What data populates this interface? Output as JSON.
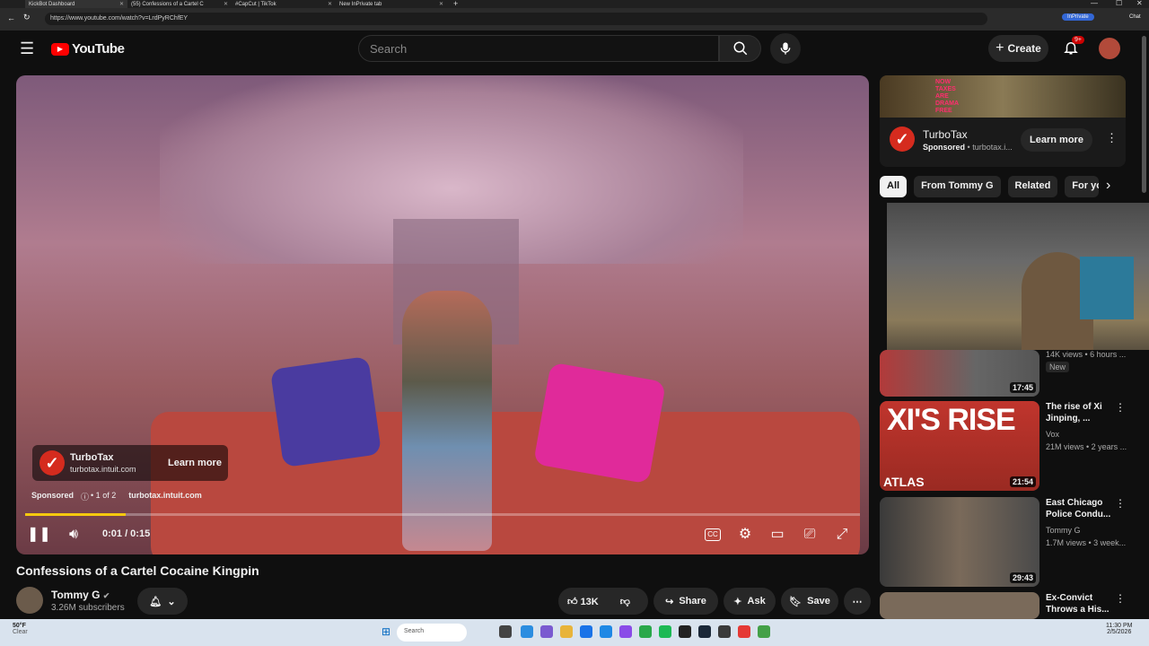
{
  "browser": {
    "tabs": [
      {
        "label": "KickBot Dashboard"
      },
      {
        "label": "(55) Confessions of a Cartel C"
      },
      {
        "label": "#CapCut | TikTok"
      },
      {
        "label": "New InPrivate tab"
      }
    ],
    "url": "https://www.youtube.com/watch?v=LrdPyRChfEY",
    "inprivate_label": "InPrivate",
    "chat_label": "Chat"
  },
  "header": {
    "logo": "YouTube",
    "search_placeholder": "Search",
    "create_label": "Create",
    "notif_badge": "9+"
  },
  "player": {
    "ad_title": "TurboTax",
    "ad_domain": "turbotax.intuit.com",
    "ad_button": "Learn more",
    "sponsored_label": "Sponsored",
    "ad_count": "• 1 of 2",
    "sponsored_domain": "turbotax.intuit.com",
    "time": "0:01 / 0:15",
    "progress_fraction": 0.12
  },
  "video": {
    "title": "Confessions of a Cartel Cocaine Kingpin",
    "channel": "Tommy G",
    "subscribers": "3.26M subscribers",
    "likes": "13K",
    "share_label": "Share",
    "ask_label": "Ask",
    "save_label": "Save"
  },
  "sidebar_ad": {
    "thumb_text": "NOW TAXES ARE DRAMA FREE",
    "advertiser": "TurboTax",
    "sponsored": "Sponsored",
    "domain": "turbotax.i...",
    "button": "Learn more"
  },
  "chips": [
    "All",
    "From Tommy G",
    "Related",
    "For you"
  ],
  "recommendations": [
    {
      "duration": "17:45",
      "meta1": "14K views • 6 hours ...",
      "badge": "New"
    },
    {
      "title": "The rise of Xi Jinping, ...",
      "channel": "Vox",
      "views": "21M views • 2 years ...",
      "duration": "21:54",
      "thumb_text": "XI'S RISE",
      "thumb_sub": "ATLAS"
    },
    {
      "title": "East Chicago Police Condu...",
      "channel": "Tommy G",
      "views": "1.7M views • 3 week...",
      "duration": "29:43"
    },
    {
      "title": "Ex-Convict Throws a His...",
      "channel": "",
      "views": ""
    }
  ],
  "taskbar": {
    "weather": "50°F",
    "weather_sub": "Clear",
    "search": "Search",
    "time": "11:30 PM",
    "date": "2/5/2026"
  }
}
